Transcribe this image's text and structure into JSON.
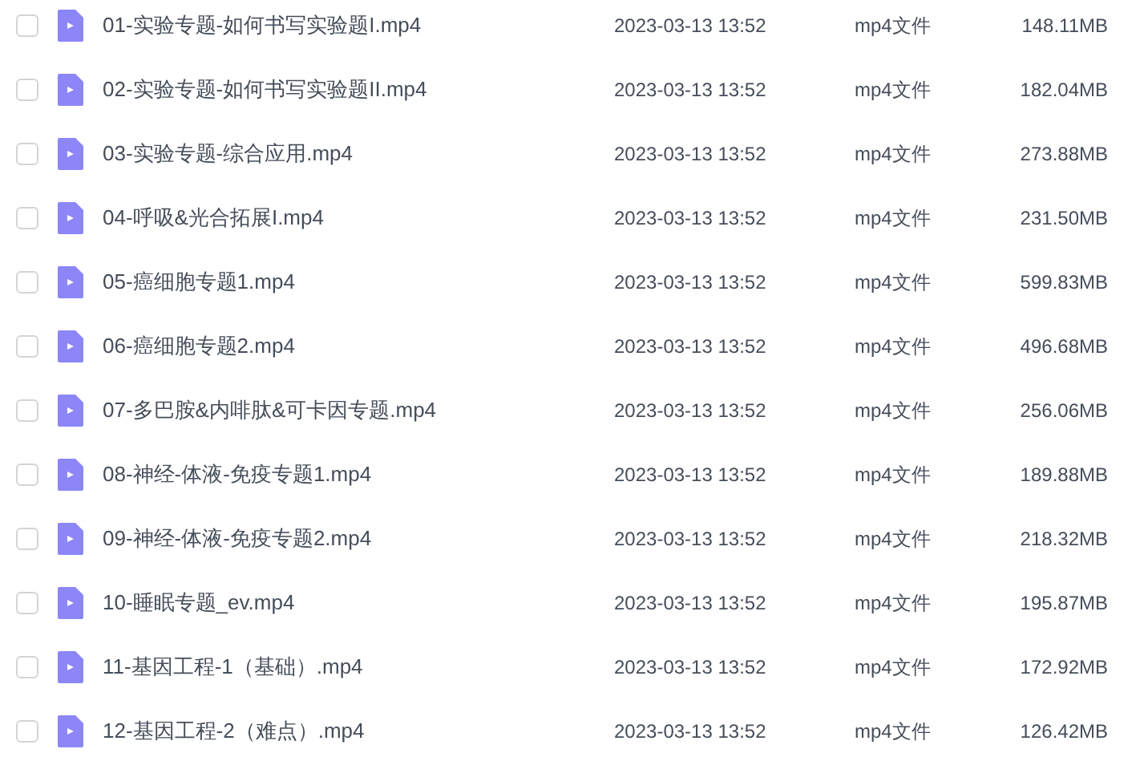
{
  "files": [
    {
      "name": "01-实验专题-如何书写实验题I.mp4",
      "date": "2023-03-13 13:52",
      "type": "mp4文件",
      "size": "148.11MB",
      "checked": false
    },
    {
      "name": "02-实验专题-如何书写实验题II.mp4",
      "date": "2023-03-13 13:52",
      "type": "mp4文件",
      "size": "182.04MB",
      "checked": false
    },
    {
      "name": "03-实验专题-综合应用.mp4",
      "date": "2023-03-13 13:52",
      "type": "mp4文件",
      "size": "273.88MB",
      "checked": false
    },
    {
      "name": "04-呼吸&光合拓展I.mp4",
      "date": "2023-03-13 13:52",
      "type": "mp4文件",
      "size": "231.50MB",
      "checked": false
    },
    {
      "name": "05-癌细胞专题1.mp4",
      "date": "2023-03-13 13:52",
      "type": "mp4文件",
      "size": "599.83MB",
      "checked": false
    },
    {
      "name": "06-癌细胞专题2.mp4",
      "date": "2023-03-13 13:52",
      "type": "mp4文件",
      "size": "496.68MB",
      "checked": false
    },
    {
      "name": "07-多巴胺&内啡肽&可卡因专题.mp4",
      "date": "2023-03-13 13:52",
      "type": "mp4文件",
      "size": "256.06MB",
      "checked": false
    },
    {
      "name": "08-神经-体液-免疫专题1.mp4",
      "date": "2023-03-13 13:52",
      "type": "mp4文件",
      "size": "189.88MB",
      "checked": false
    },
    {
      "name": "09-神经-体液-免疫专题2.mp4",
      "date": "2023-03-13 13:52",
      "type": "mp4文件",
      "size": "218.32MB",
      "checked": false
    },
    {
      "name": "10-睡眠专题_ev.mp4",
      "date": "2023-03-13 13:52",
      "type": "mp4文件",
      "size": "195.87MB",
      "checked": false
    },
    {
      "name": "11-基因工程-1（基础）.mp4",
      "date": "2023-03-13 13:52",
      "type": "mp4文件",
      "size": "172.92MB",
      "checked": false
    },
    {
      "name": "12-基因工程-2（难点）.mp4",
      "date": "2023-03-13 13:52",
      "type": "mp4文件",
      "size": "126.42MB",
      "checked": false
    }
  ]
}
